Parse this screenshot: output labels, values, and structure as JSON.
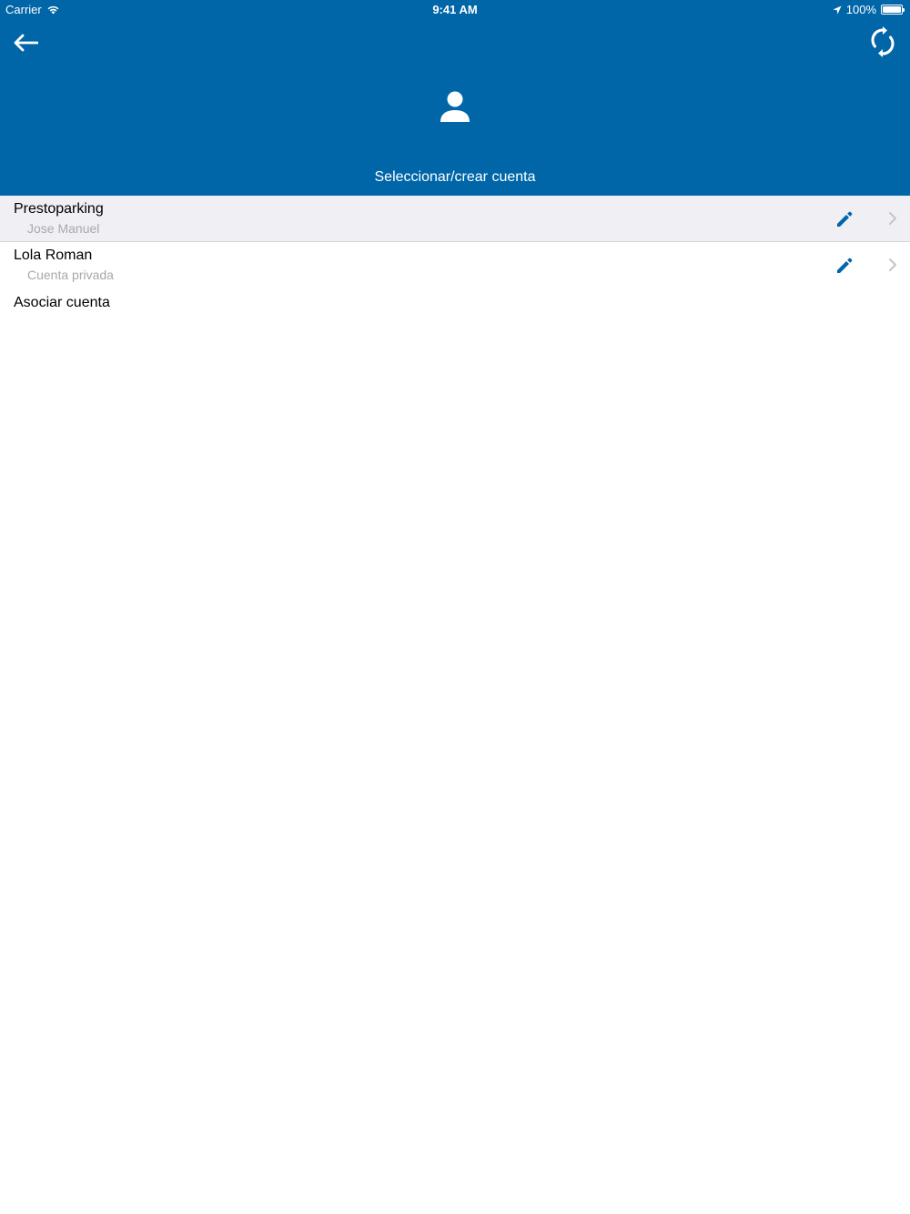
{
  "status_bar": {
    "carrier": "Carrier",
    "time": "9:41 AM",
    "battery": "100%",
    "battery_level": 1.0
  },
  "header": {
    "back_icon": "arrow-left-icon",
    "sync_icon": "sync-icon",
    "avatar_icon": "person-icon",
    "title": "Seleccionar/crear cuenta"
  },
  "accounts": [
    {
      "name": "Prestoparking",
      "subtitle": "Jose Manuel",
      "selected": true
    },
    {
      "name": "Lola Roman",
      "subtitle": "Cuenta privada",
      "selected": false
    }
  ],
  "associate": {
    "label": "Asociar cuenta"
  },
  "colors": {
    "header_bg": "#0066a8",
    "selected_row_bg": "#efeff4",
    "accent": "#0066a8",
    "subtitle": "#a8a8ad"
  }
}
